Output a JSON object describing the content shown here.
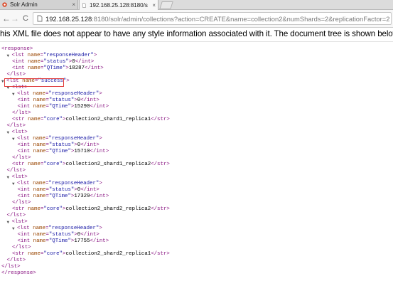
{
  "tabs": [
    {
      "label": "Solr Admin",
      "close": "×"
    },
    {
      "label": "192.168.25.128:8180/s",
      "close": "×"
    }
  ],
  "url": {
    "host": "192.168.25.128",
    "rest": ":8180/solr/admin/collections?action=CREATE&name=collection2&numShards=2&replicationFactor=2"
  },
  "notice": "his XML file does not appear to have any style information associated with it. The document tree is shown below.",
  "xml": [
    {
      "indent": 0,
      "open": "response"
    },
    {
      "indent": 1,
      "toggle": true,
      "open": "lst",
      "name": "responseHeader"
    },
    {
      "indent": 2,
      "el": "int",
      "name": "status",
      "value": "0"
    },
    {
      "indent": 2,
      "el": "int",
      "name": "QTime",
      "value": "18287"
    },
    {
      "indent": 1,
      "close": "lst"
    },
    {
      "indent": 0,
      "toggle": true,
      "open": "lst",
      "name": "success"
    },
    {
      "indent": 1,
      "toggle": true,
      "open": "lst"
    },
    {
      "indent": 2,
      "toggle": true,
      "open": "lst",
      "name": "responseHeader"
    },
    {
      "indent": 3,
      "el": "int",
      "name": "status",
      "value": "0"
    },
    {
      "indent": 3,
      "el": "int",
      "name": "QTime",
      "value": "15290"
    },
    {
      "indent": 2,
      "close": "lst"
    },
    {
      "indent": 2,
      "el": "str",
      "name": "core",
      "value": "collection2_shard1_replica1"
    },
    {
      "indent": 1,
      "close": "lst"
    },
    {
      "indent": 1,
      "toggle": true,
      "open": "lst"
    },
    {
      "indent": 2,
      "toggle": true,
      "open": "lst",
      "name": "responseHeader"
    },
    {
      "indent": 3,
      "el": "int",
      "name": "status",
      "value": "0"
    },
    {
      "indent": 3,
      "el": "int",
      "name": "QTime",
      "value": "15710"
    },
    {
      "indent": 2,
      "close": "lst"
    },
    {
      "indent": 2,
      "el": "str",
      "name": "core",
      "value": "collection2_shard1_replica2"
    },
    {
      "indent": 1,
      "close": "lst"
    },
    {
      "indent": 1,
      "toggle": true,
      "open": "lst"
    },
    {
      "indent": 2,
      "toggle": true,
      "open": "lst",
      "name": "responseHeader"
    },
    {
      "indent": 3,
      "el": "int",
      "name": "status",
      "value": "0"
    },
    {
      "indent": 3,
      "el": "int",
      "name": "QTime",
      "value": "17329"
    },
    {
      "indent": 2,
      "close": "lst"
    },
    {
      "indent": 2,
      "el": "str",
      "name": "core",
      "value": "collection2_shard2_replica2"
    },
    {
      "indent": 1,
      "close": "lst"
    },
    {
      "indent": 1,
      "toggle": true,
      "open": "lst"
    },
    {
      "indent": 2,
      "toggle": true,
      "open": "lst",
      "name": "responseHeader"
    },
    {
      "indent": 3,
      "el": "int",
      "name": "status",
      "value": "0"
    },
    {
      "indent": 3,
      "el": "int",
      "name": "QTime",
      "value": "17755"
    },
    {
      "indent": 2,
      "close": "lst"
    },
    {
      "indent": 2,
      "el": "str",
      "name": "core",
      "value": "collection2_shard2_replica1"
    },
    {
      "indent": 1,
      "close": "lst"
    },
    {
      "indent": 0,
      "close": "lst"
    },
    {
      "indent": 0,
      "close": "response"
    }
  ]
}
